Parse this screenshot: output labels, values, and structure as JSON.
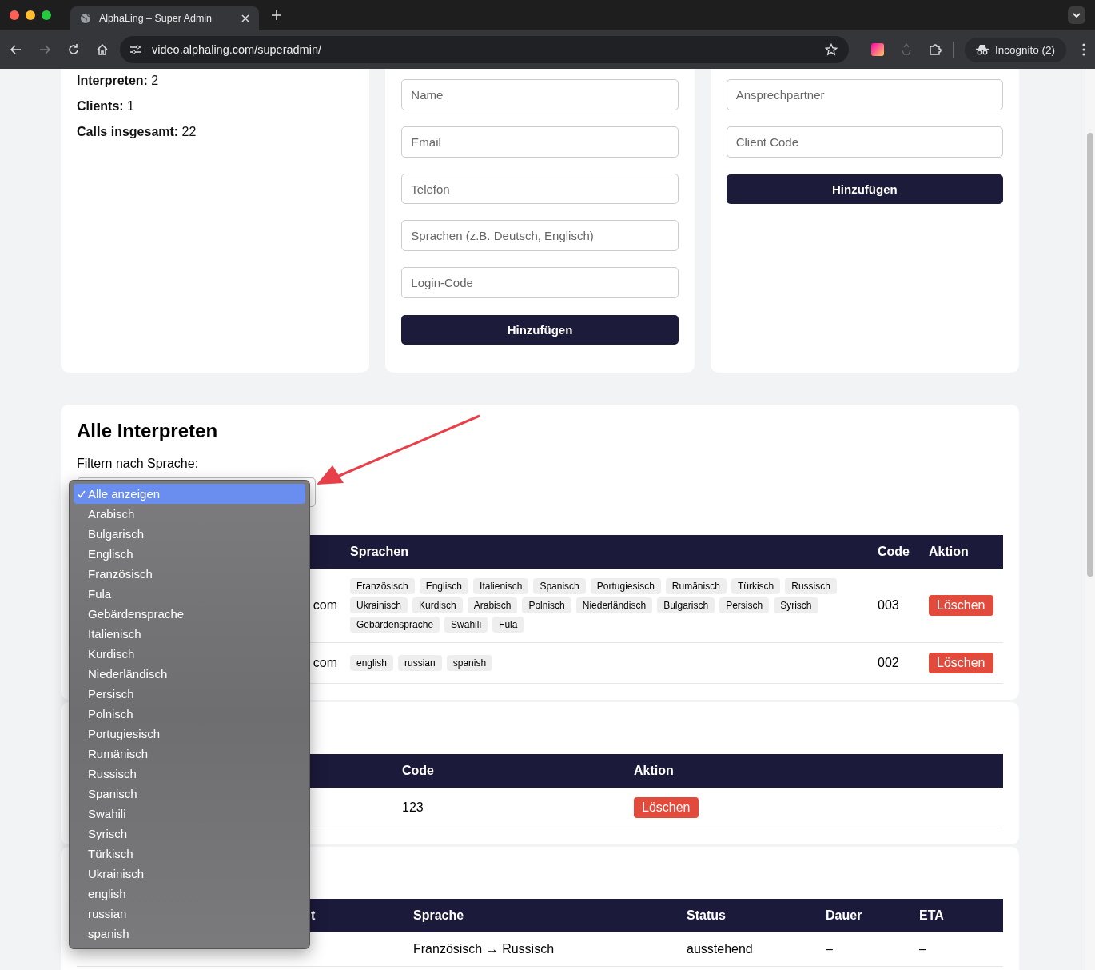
{
  "browser": {
    "tab_title": "AlphaLing – Super Admin",
    "url": "video.alphaling.com/superadmin/",
    "profile": "Incognito (2)"
  },
  "stats": [
    {
      "label": "Interpreten:",
      "value": "2"
    },
    {
      "label": "Clients:",
      "value": "1"
    },
    {
      "label": "Calls insgesamt:",
      "value": "22"
    }
  ],
  "interpreter_form": {
    "fields": [
      {
        "placeholder": "Name"
      },
      {
        "placeholder": "Email"
      },
      {
        "placeholder": "Telefon"
      },
      {
        "placeholder": "Sprachen (z.B. Deutsch, Englisch)"
      },
      {
        "placeholder": "Login-Code"
      }
    ],
    "button": "Hinzufügen"
  },
  "client_form": {
    "fields": [
      {
        "placeholder": "Ansprechpartner"
      },
      {
        "placeholder": "Client Code"
      }
    ],
    "button": "Hinzufügen"
  },
  "interpreters": {
    "title": "Alle Interpreten",
    "filter_label": "Filtern nach Sprache:",
    "filter_menu": [
      {
        "label": "Alle anzeigen",
        "selected": true
      },
      {
        "label": "Arabisch",
        "selected": false
      },
      {
        "label": "Bulgarisch",
        "selected": false
      },
      {
        "label": "Englisch",
        "selected": false
      },
      {
        "label": "Französisch",
        "selected": false
      },
      {
        "label": "Fula",
        "selected": false
      },
      {
        "label": "Gebärdensprache",
        "selected": false
      },
      {
        "label": "Italienisch",
        "selected": false
      },
      {
        "label": "Kurdisch",
        "selected": false
      },
      {
        "label": "Niederländisch",
        "selected": false
      },
      {
        "label": "Persisch",
        "selected": false
      },
      {
        "label": "Polnisch",
        "selected": false
      },
      {
        "label": "Portugiesisch",
        "selected": false
      },
      {
        "label": "Rumänisch",
        "selected": false
      },
      {
        "label": "Russisch",
        "selected": false
      },
      {
        "label": "Spanisch",
        "selected": false
      },
      {
        "label": "Swahili",
        "selected": false
      },
      {
        "label": "Syrisch",
        "selected": false
      },
      {
        "label": "Türkisch",
        "selected": false
      },
      {
        "label": "Ukrainisch",
        "selected": false
      },
      {
        "label": "english",
        "selected": false
      },
      {
        "label": "russian",
        "selected": false
      },
      {
        "label": "spanish",
        "selected": false
      }
    ],
    "columns": [
      "Sprachen",
      "Code",
      "Aktion"
    ],
    "rows": [
      {
        "email": "com",
        "languages": [
          "Französisch",
          "Englisch",
          "Italienisch",
          "Spanisch",
          "Portugiesisch",
          "Rumänisch",
          "Türkisch",
          "Russisch",
          "Ukrainisch",
          "Kurdisch",
          "Arabisch",
          "Polnisch",
          "Niederländisch",
          "Bulgarisch",
          "Persisch",
          "Syrisch",
          "Gebärdensprache",
          "Swahili",
          "Fula"
        ],
        "code": "003",
        "action": "Löschen"
      },
      {
        "email": "com",
        "languages": [
          "english",
          "russian",
          "spanish"
        ],
        "code": "002",
        "action": "Löschen"
      }
    ]
  },
  "clients": {
    "columns": [
      "Code",
      "Aktion"
    ],
    "rows": [
      {
        "code": "123",
        "action": "Löschen"
      }
    ]
  },
  "calls": {
    "columns": [
      "t",
      "Sprache",
      "Status",
      "Dauer",
      "ETA"
    ],
    "rows": [
      {
        "language": "Französisch → Russisch",
        "status": "ausstehend",
        "duration": "–",
        "eta": "–"
      }
    ]
  }
}
